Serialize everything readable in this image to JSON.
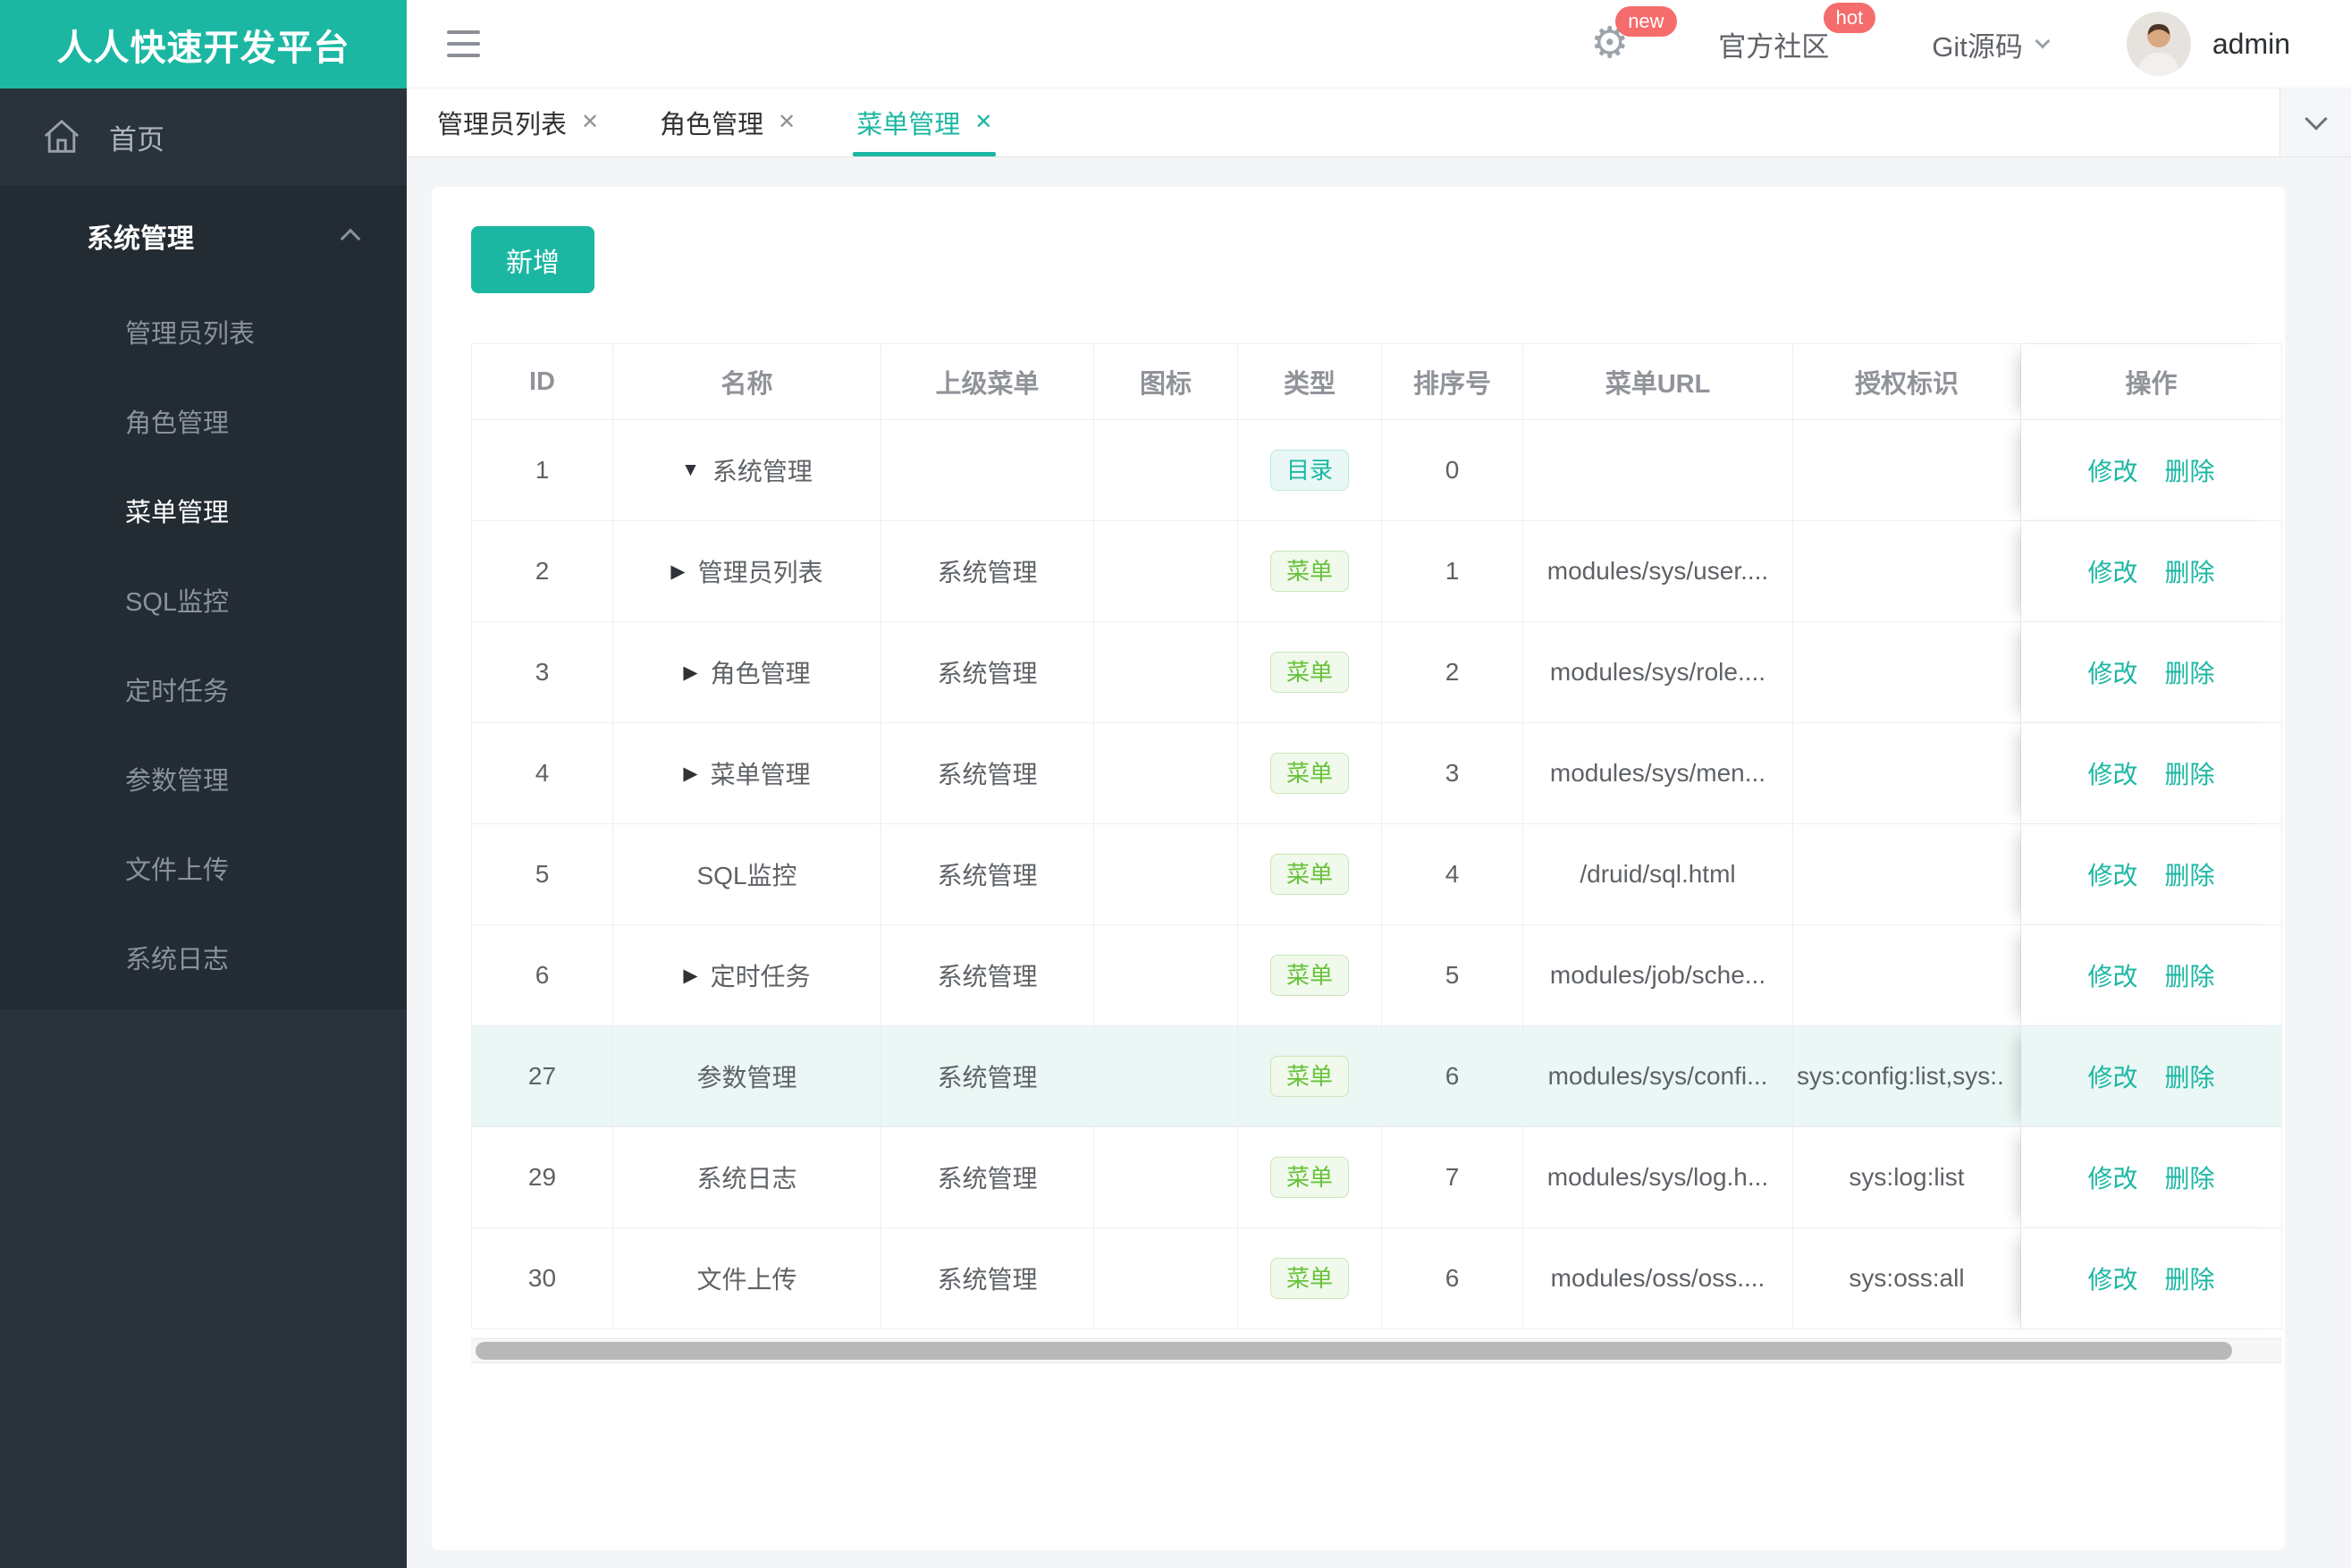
{
  "app_title": "人人快速开发平台",
  "topbar": {
    "new_badge": "new",
    "community": "官方社区",
    "hot_badge": "hot",
    "git": "Git源码",
    "username": "admin"
  },
  "sidebar": {
    "home": "首页",
    "section": {
      "title": "系统管理",
      "items": [
        "管理员列表",
        "角色管理",
        "菜单管理",
        "SQL监控",
        "定时任务",
        "参数管理",
        "文件上传",
        "系统日志"
      ],
      "active": "菜单管理"
    }
  },
  "tabs": {
    "items": [
      {
        "label": "管理员列表"
      },
      {
        "label": "角色管理"
      },
      {
        "label": "菜单管理"
      }
    ],
    "active": "菜单管理"
  },
  "toolbar": {
    "add": "新增"
  },
  "table": {
    "columns": [
      "ID",
      "名称",
      "上级菜单",
      "图标",
      "类型",
      "排序号",
      "菜单URL",
      "授权标识",
      "操作"
    ],
    "edit": "修改",
    "delete": "删除",
    "rows": [
      {
        "id": "1",
        "arrow": "▼",
        "name": "系统管理",
        "parent": "",
        "icon": "",
        "type": "目录",
        "sort": "0",
        "url": "",
        "perm": ""
      },
      {
        "id": "2",
        "arrow": "▶",
        "name": "管理员列表",
        "parent": "系统管理",
        "icon": "",
        "type": "菜单",
        "sort": "1",
        "url": "modules/sys/user....",
        "perm": ""
      },
      {
        "id": "3",
        "arrow": "▶",
        "name": "角色管理",
        "parent": "系统管理",
        "icon": "",
        "type": "菜单",
        "sort": "2",
        "url": "modules/sys/role....",
        "perm": ""
      },
      {
        "id": "4",
        "arrow": "▶",
        "name": "菜单管理",
        "parent": "系统管理",
        "icon": "",
        "type": "菜单",
        "sort": "3",
        "url": "modules/sys/men...",
        "perm": ""
      },
      {
        "id": "5",
        "arrow": "",
        "name": "SQL监控",
        "parent": "系统管理",
        "icon": "",
        "type": "菜单",
        "sort": "4",
        "url": "/druid/sql.html",
        "perm": ""
      },
      {
        "id": "6",
        "arrow": "▶",
        "name": "定时任务",
        "parent": "系统管理",
        "icon": "",
        "type": "菜单",
        "sort": "5",
        "url": "modules/job/sche...",
        "perm": ""
      },
      {
        "id": "27",
        "arrow": "",
        "name": "参数管理",
        "parent": "系统管理",
        "icon": "",
        "type": "菜单",
        "sort": "6",
        "url": "modules/sys/confi...",
        "perm": "sys:config:list,sys:."
      },
      {
        "id": "29",
        "arrow": "",
        "name": "系统日志",
        "parent": "系统管理",
        "icon": "",
        "type": "菜单",
        "sort": "7",
        "url": "modules/sys/log.h...",
        "perm": "sys:log:list"
      },
      {
        "id": "30",
        "arrow": "",
        "name": "文件上传",
        "parent": "系统管理",
        "icon": "",
        "type": "菜单",
        "sort": "6",
        "url": "modules/oss/oss....",
        "perm": "sys:oss:all"
      }
    ]
  },
  "colors": {
    "accent_teal": "#1BB7A3",
    "badge_red": "#F56C6C",
    "tag_dir_teal": "#1BB7A3",
    "tag_menu_green": "#67C23A",
    "sidebar_bg": "#2A333C",
    "sidebar_section_bg": "#232B33",
    "highlight_row": "#EAF7F4"
  }
}
